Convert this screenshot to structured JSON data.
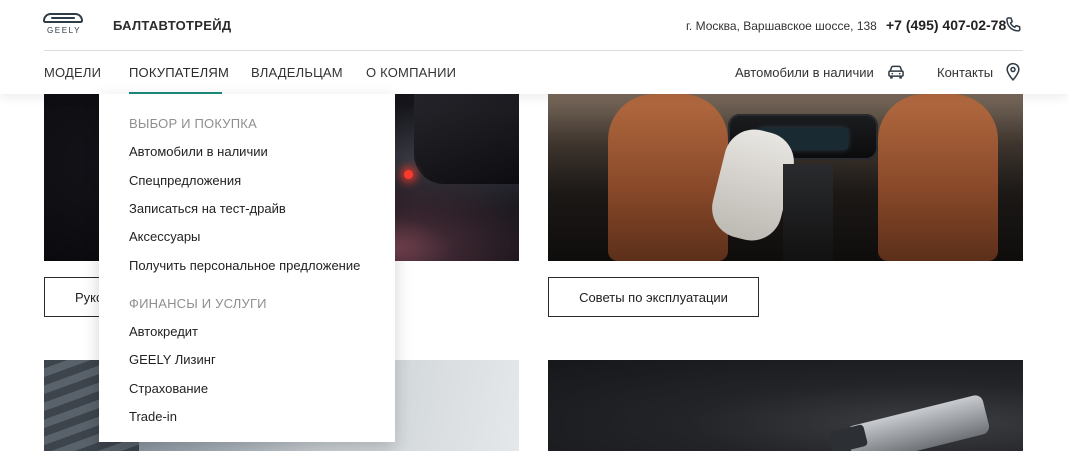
{
  "header": {
    "logo_text": "GEELY",
    "brand": "БАЛТАВТОТРЕЙД",
    "address": "г. Москва, Варшавское шоссе, 138",
    "phone": "+7 (495) 407-02-78"
  },
  "nav": {
    "items": [
      {
        "label": "МОДЕЛИ"
      },
      {
        "label": "ПОКУПАТЕЛЯМ"
      },
      {
        "label": "ВЛАДЕЛЬЦАМ"
      },
      {
        "label": "О КОМПАНИИ"
      }
    ],
    "active_index": 1,
    "cars_in_stock": "Автомобили в наличии",
    "contacts": "Контакты"
  },
  "dropdown": {
    "sections": [
      {
        "heading": "ВЫБОР И ПОКУПКА",
        "items": [
          "Автомобили в наличии",
          "Спецпредложения",
          "Записаться на тест-драйв",
          "Аксессуары",
          "Получить персональное предложение"
        ]
      },
      {
        "heading": "ФИНАНСЫ И УСЛУГИ",
        "items": [
          "Автокредит",
          "GEELY Лизинг",
          "Страхование",
          "Trade-in"
        ]
      }
    ]
  },
  "content": {
    "left_button_visible": "Руко",
    "right_button": "Советы по эксплуатации"
  },
  "colors": {
    "accent": "#1c8c7d",
    "text": "#222222",
    "muted": "#8f8f8f"
  },
  "icons": {
    "phone": "phone-icon",
    "car": "car-icon",
    "location": "location-pin-icon",
    "logo": "geely-logo"
  }
}
